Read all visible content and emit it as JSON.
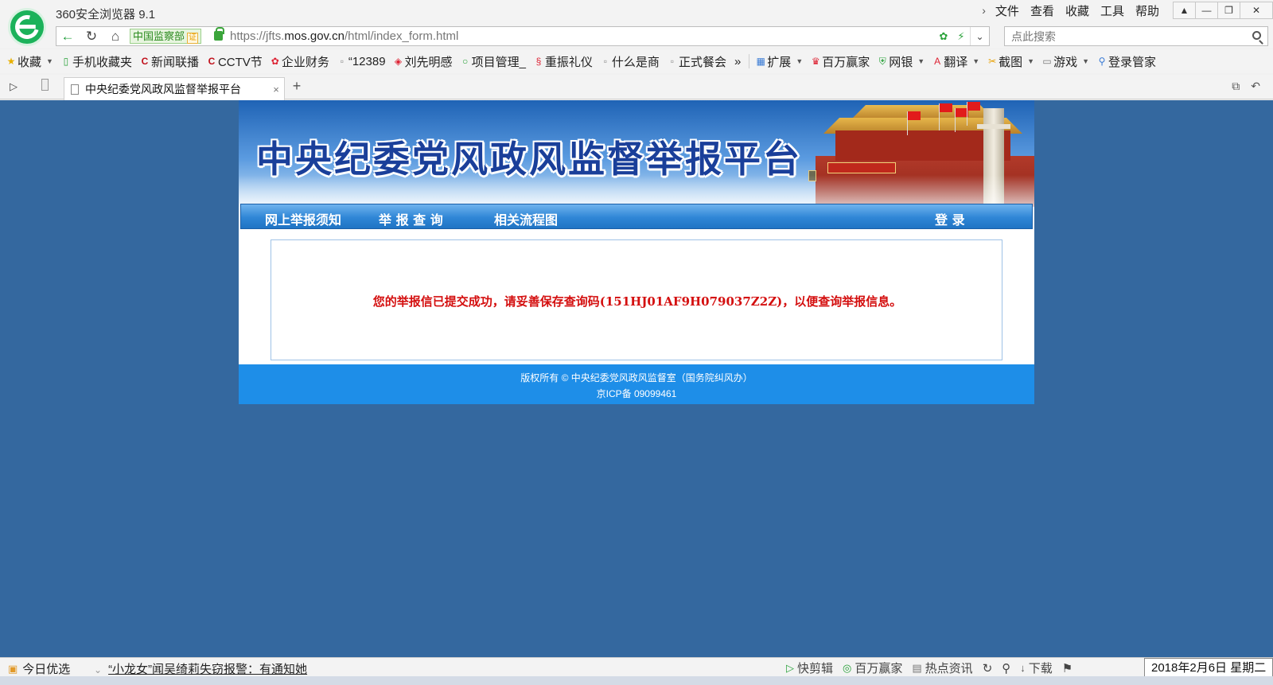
{
  "browser": {
    "title": "360安全浏览器 9.1",
    "menu": [
      "文件",
      "查看",
      "收藏",
      "工具",
      "帮助"
    ],
    "address": {
      "cert_label": "中国监察部",
      "cert_badge": "证",
      "url_prefix": "https://jfts.",
      "url_domain": "mos.gov.cn",
      "url_path": "/html/index_form.html"
    },
    "search_placeholder": "点此搜索",
    "bookmarks": [
      {
        "label": "收藏",
        "icon": "star-icon"
      },
      {
        "label": "手机收藏夹",
        "icon": "phone-icon"
      },
      {
        "label": "新闻联播",
        "icon": "cctv-icon"
      },
      {
        "label": "CCTV节",
        "icon": "cctv-icon"
      },
      {
        "label": "企业财务",
        "icon": "badge-icon"
      },
      {
        "label": "“12389",
        "icon": "page-icon"
      },
      {
        "label": "刘先明感",
        "icon": "badge-icon"
      },
      {
        "label": "项目管理_",
        "icon": "circle-icon"
      },
      {
        "label": "重振礼仪",
        "icon": "badge-icon"
      },
      {
        "label": "什么是商",
        "icon": "page-icon"
      },
      {
        "label": "正式餐会",
        "icon": "page-icon"
      }
    ],
    "bookmark_more": "»",
    "extensions": [
      {
        "label": "扩展",
        "icon": "extension-icon"
      },
      {
        "label": "百万赢家",
        "icon": "trophy-icon"
      },
      {
        "label": "网银",
        "icon": "shield-icon"
      },
      {
        "label": "翻译",
        "icon": "translate-icon"
      },
      {
        "label": "截图",
        "icon": "scissors-icon"
      },
      {
        "label": "游戏",
        "icon": "gamepad-icon"
      },
      {
        "label": "登录管家",
        "icon": "key-icon"
      }
    ],
    "tab": {
      "title": "中央纪委党风政风监督举报平台",
      "close": "×"
    },
    "new_tab": "+"
  },
  "site": {
    "title": "中央纪委党风政风监督举报平台",
    "nav": [
      {
        "label": "网上举报须知"
      },
      {
        "label": "举 报 查 询"
      },
      {
        "label": "相关流程图"
      },
      {
        "label": "登  录"
      }
    ],
    "message": "您的举报信已提交成功，请妥善保存查询码(151HJ01AF9H079037Z2Z)，以便查询举报信息。",
    "footer_line1": "版权所有 © 中央纪委党风政风监督室（国务院纠风办）",
    "footer_line2": "京ICP备 09099461"
  },
  "statusbar": {
    "today": "今日优选",
    "news": "“小龙女”闻吴绮莉失窃报警：有通知她",
    "items": [
      "快剪辑",
      "百万赢家",
      "热点资讯"
    ],
    "download": "下载",
    "date": "2018年2月6日 星期二"
  }
}
